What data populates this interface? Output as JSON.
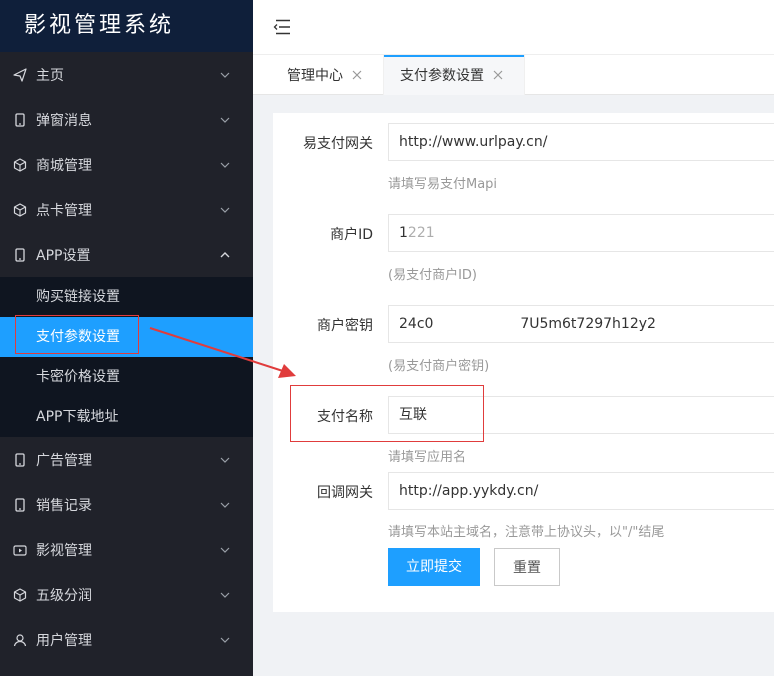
{
  "app": {
    "title": "影视管理系统"
  },
  "sidebar": {
    "items": [
      {
        "label": "主页",
        "icon": "send-icon",
        "expanded": false
      },
      {
        "label": "弹窗消息",
        "icon": "phone-icon",
        "expanded": false
      },
      {
        "label": "商城管理",
        "icon": "cube-icon",
        "expanded": false
      },
      {
        "label": "点卡管理",
        "icon": "cube-icon",
        "expanded": false
      },
      {
        "label": "APP设置",
        "icon": "phone-icon",
        "expanded": true
      },
      {
        "label": "广告管理",
        "icon": "phone-icon",
        "expanded": false
      },
      {
        "label": "销售记录",
        "icon": "phone-icon",
        "expanded": false
      },
      {
        "label": "影视管理",
        "icon": "video-icon",
        "expanded": false
      },
      {
        "label": "五级分润",
        "icon": "cube-icon",
        "expanded": false
      },
      {
        "label": "用户管理",
        "icon": "user-icon",
        "expanded": false
      }
    ],
    "submenu": [
      {
        "label": "购买链接设置",
        "active": false
      },
      {
        "label": "支付参数设置",
        "active": true
      },
      {
        "label": "卡密价格设置",
        "active": false
      },
      {
        "label": "APP下载地址",
        "active": false
      }
    ]
  },
  "tabs": [
    {
      "label": "管理中心",
      "active": false
    },
    {
      "label": "支付参数设置",
      "active": true
    }
  ],
  "form": {
    "gateway": {
      "label": "易支付网关",
      "value": "http://www.urlpay.cn/",
      "hint": "请填写易支付Mapi"
    },
    "merchant_id": {
      "label": "商户ID",
      "value": "1221",
      "hint": "(易支付商户ID)"
    },
    "merchant_key": {
      "label": "商户密钥",
      "value_start": "24c0",
      "value_end": "7U5m6t7297h12y2",
      "hint": "(易支付商户密钥)"
    },
    "pay_name": {
      "label": "支付名称",
      "value": "互联",
      "hint": "请填写应用名"
    },
    "callback": {
      "label": "回调网关",
      "value": "http://app.yykdy.cn/",
      "hint": "请填写本站主域名，注意带上协议头，以\"/\"结尾"
    },
    "submit_label": "立即提交",
    "reset_label": "重置"
  },
  "colors": {
    "sidebar_bg": "#20222a",
    "brand_bg": "#0f1f3a",
    "accent": "#1e9fff",
    "annotation": "#e03c3c"
  }
}
